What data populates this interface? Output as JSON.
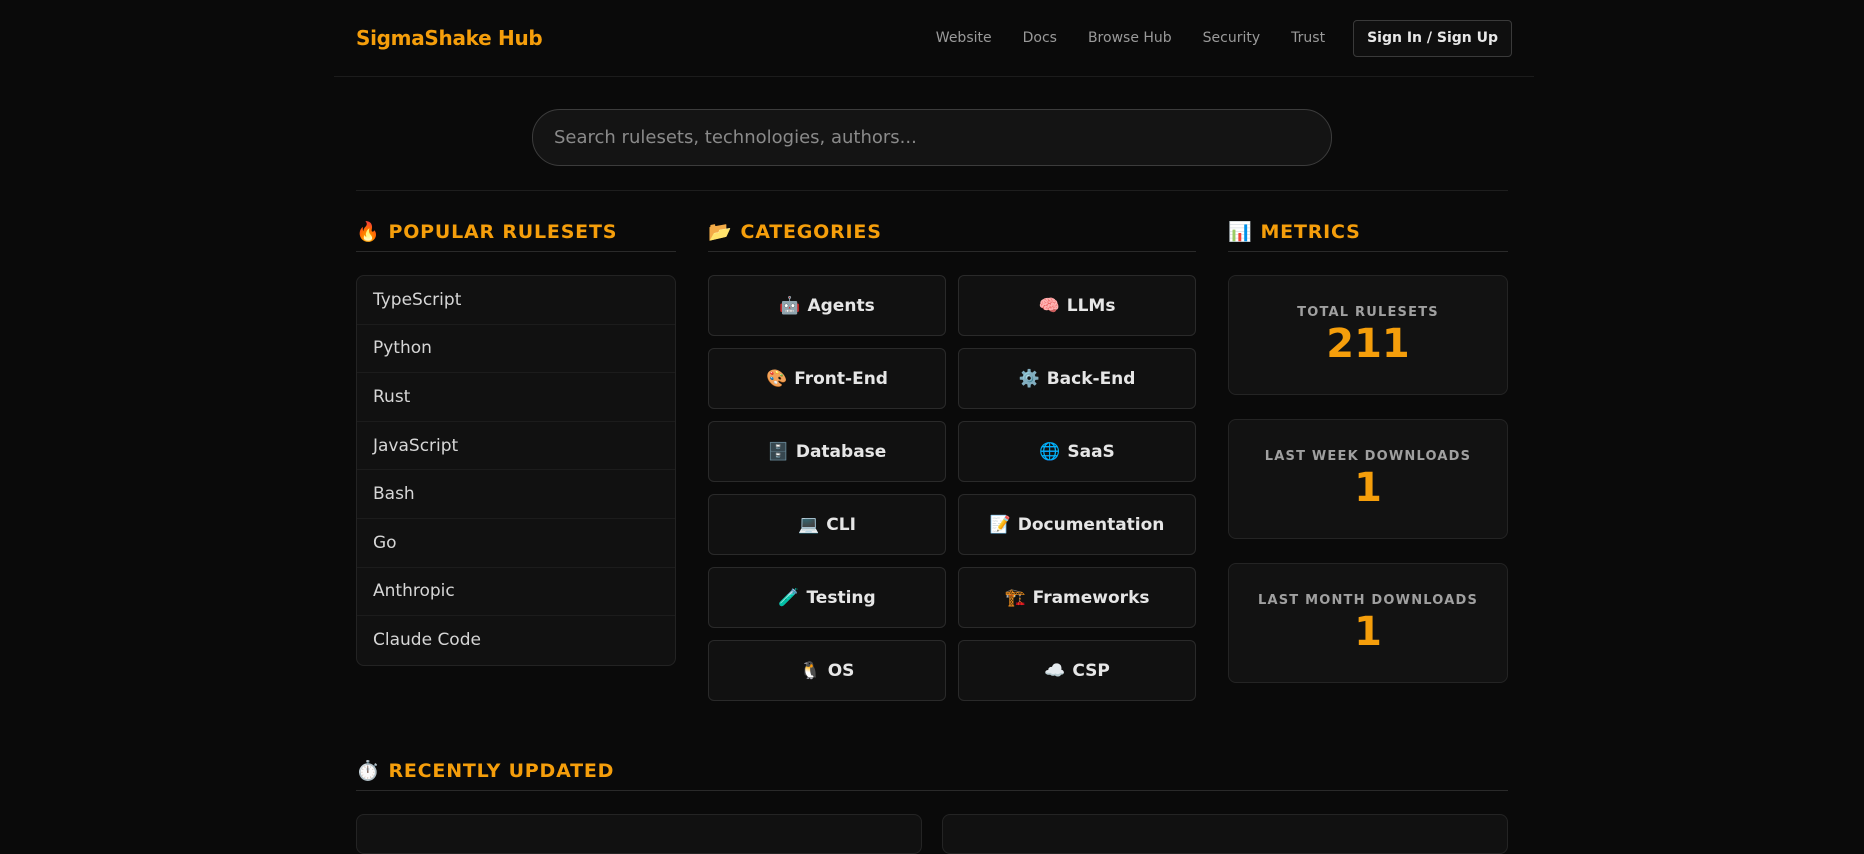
{
  "brand": "SigmaShake Hub",
  "nav": {
    "items": [
      "Website",
      "Docs",
      "Browse Hub",
      "Security",
      "Trust"
    ],
    "signin_label": "Sign In / Sign Up"
  },
  "search": {
    "placeholder": "Search rulesets, technologies, authors..."
  },
  "popular": {
    "icon": "🔥",
    "title": "POPULAR RULESETS",
    "items": [
      "TypeScript",
      "Python",
      "Rust",
      "JavaScript",
      "Bash",
      "Go",
      "Anthropic",
      "Claude Code"
    ]
  },
  "categories": {
    "icon": "📂",
    "title": "CATEGORIES",
    "items": [
      {
        "icon": "🤖",
        "label": "Agents"
      },
      {
        "icon": "🧠",
        "label": "LLMs"
      },
      {
        "icon": "🎨",
        "label": "Front-End"
      },
      {
        "icon": "⚙️",
        "label": "Back-End"
      },
      {
        "icon": "🗄️",
        "label": "Database"
      },
      {
        "icon": "🌐",
        "label": "SaaS"
      },
      {
        "icon": "💻",
        "label": "CLI"
      },
      {
        "icon": "📝",
        "label": "Documentation"
      },
      {
        "icon": "🧪",
        "label": "Testing"
      },
      {
        "icon": "🏗️",
        "label": "Frameworks"
      },
      {
        "icon": "🐧",
        "label": "OS"
      },
      {
        "icon": "☁️",
        "label": "CSP"
      }
    ]
  },
  "metrics": {
    "icon": "📊",
    "title": "METRICS",
    "items": [
      {
        "label": "TOTAL RULESETS",
        "value": "211"
      },
      {
        "label": "LAST WEEK DOWNLOADS",
        "value": "1"
      },
      {
        "label": "LAST MONTH DOWNLOADS",
        "value": "1"
      }
    ]
  },
  "recent": {
    "icon": "⏱️",
    "title": "RECENTLY UPDATED"
  },
  "colors": {
    "accent": "#f59e0b",
    "background": "#0a0a0a",
    "card": "#111111"
  }
}
